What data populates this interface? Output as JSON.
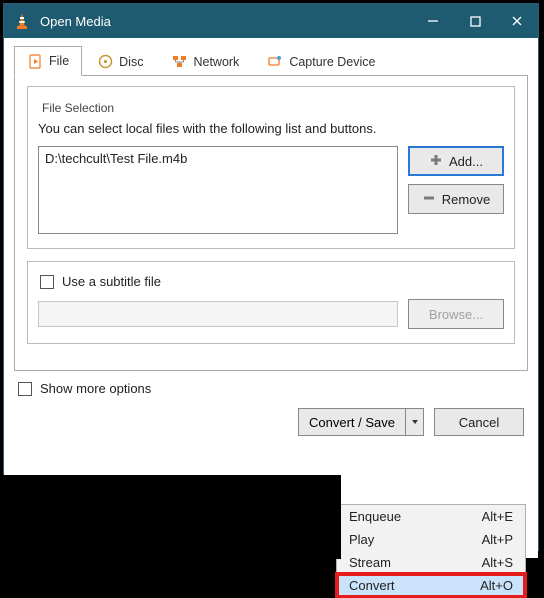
{
  "titlebar": {
    "title": "Open Media"
  },
  "tabs": {
    "file": "File",
    "disc": "Disc",
    "network": "Network",
    "capture": "Capture Device"
  },
  "file_selection": {
    "legend": "File Selection",
    "instructions": "You can select local files with the following list and buttons.",
    "selected_file": "D:\\techcult\\Test File.m4b",
    "add_label": "Add...",
    "remove_label": "Remove"
  },
  "subtitle": {
    "checkbox_label": "Use a subtitle file",
    "browse_label": "Browse..."
  },
  "show_more": {
    "label": "Show more options"
  },
  "footer": {
    "convert_save": "Convert / Save",
    "cancel": "Cancel"
  },
  "dropdown": {
    "enqueue": {
      "label": "Enqueue",
      "shortcut": "Alt+E"
    },
    "play": {
      "label": "Play",
      "shortcut": "Alt+P"
    },
    "stream": {
      "label": "Stream",
      "shortcut": "Alt+S"
    },
    "convert": {
      "label": "Convert",
      "shortcut": "Alt+O"
    }
  }
}
